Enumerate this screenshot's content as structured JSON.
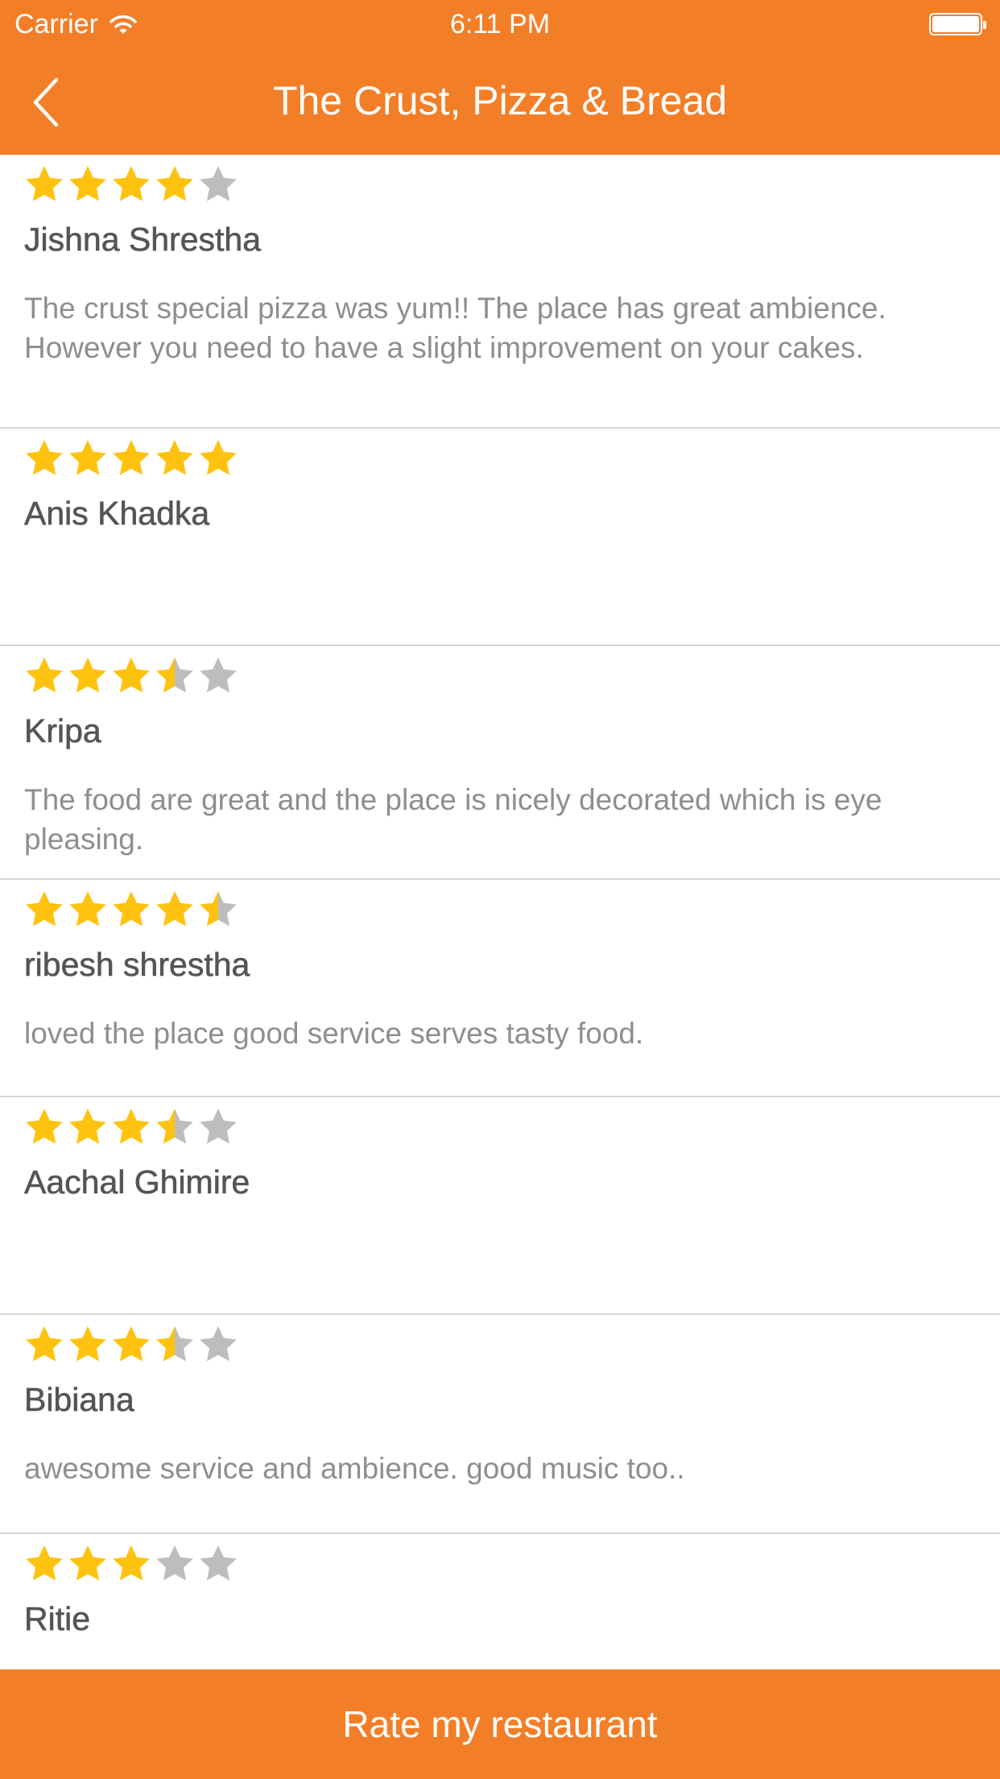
{
  "status_bar": {
    "carrier": "Carrier",
    "time": "6:11 PM"
  },
  "nav": {
    "title": "The Crust, Pizza & Bread"
  },
  "colors": {
    "accent": "#F37E28",
    "star_filled": "#FFC20E",
    "star_empty": "#BDBDBD"
  },
  "reviews": [
    {
      "name": "Jishna Shrestha",
      "rating": 4,
      "comment": "The crust special pizza was yum!! The place has great ambience.\nHowever you need to have a slight improvement on your cakes."
    },
    {
      "name": "Anis Khadka",
      "rating": 5,
      "comment": ""
    },
    {
      "name": "Kripa",
      "rating": 3.5,
      "comment": "The food are great and the place is nicely decorated which is eye pleasing."
    },
    {
      "name": "ribesh shrestha",
      "rating": 4.5,
      "comment": "loved the place good service serves tasty food."
    },
    {
      "name": "Aachal Ghimire",
      "rating": 3.5,
      "comment": ""
    },
    {
      "name": "Bibiana",
      "rating": 3.5,
      "comment": "awesome service and ambience. good music too.."
    },
    {
      "name": "Ritie",
      "rating": 3,
      "comment": ""
    }
  ],
  "footer": {
    "rate_label": "Rate my restaurant"
  }
}
